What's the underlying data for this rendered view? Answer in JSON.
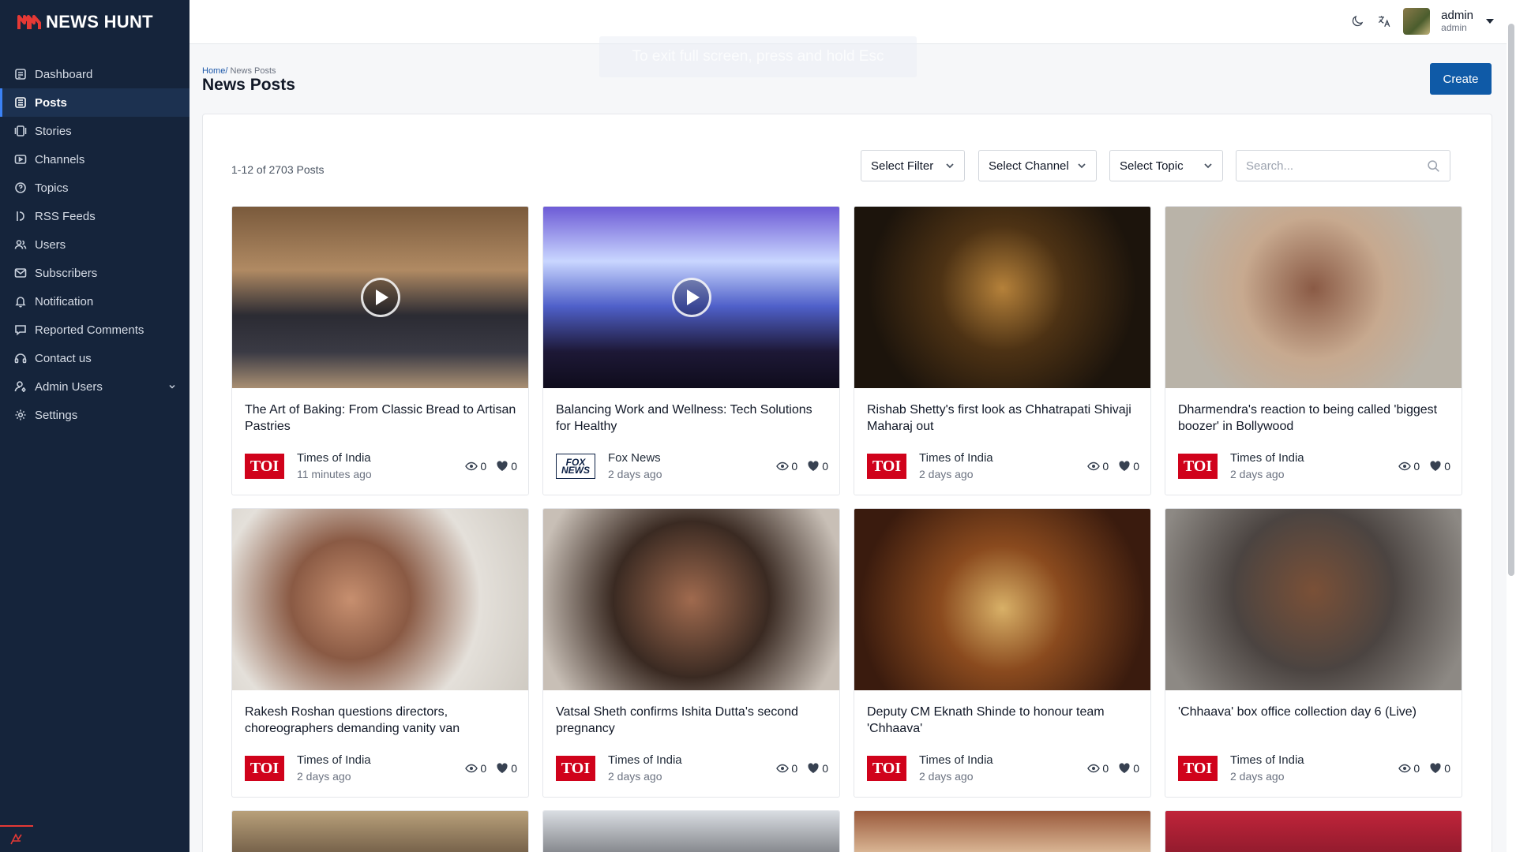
{
  "brand": {
    "name": "NEWS HUNT",
    "accent": "#e53935"
  },
  "sidebar": {
    "items": [
      {
        "label": "Dashboard",
        "icon": "dashboard-icon"
      },
      {
        "label": "Posts",
        "icon": "posts-icon",
        "active": true
      },
      {
        "label": "Stories",
        "icon": "stories-icon"
      },
      {
        "label": "Channels",
        "icon": "channels-icon"
      },
      {
        "label": "Topics",
        "icon": "topics-icon"
      },
      {
        "label": "RSS Feeds",
        "icon": "rss-icon"
      },
      {
        "label": "Users",
        "icon": "users-icon"
      },
      {
        "label": "Subscribers",
        "icon": "mail-icon"
      },
      {
        "label": "Notification",
        "icon": "bell-icon"
      },
      {
        "label": "Reported Comments",
        "icon": "comment-icon"
      },
      {
        "label": "Contact us",
        "icon": "contact-icon"
      },
      {
        "label": "Admin Users",
        "icon": "admin-icon"
      },
      {
        "label": "Settings",
        "icon": "gear-icon"
      }
    ]
  },
  "header": {
    "user_name": "admin",
    "user_role": "admin",
    "fullscreen_hint": "To exit full screen, press and hold Esc"
  },
  "page": {
    "breadcrumb_home": "Home/",
    "breadcrumb_current": " News Posts",
    "title": "News Posts",
    "create_label": "Create"
  },
  "toolbar": {
    "count": "1-12 of 2703 Posts",
    "filter_label": "Select Filter",
    "channel_label": "Select Channel",
    "topic_label": "Select Topic",
    "search_placeholder": "Search..."
  },
  "posts": [
    {
      "title": "The Art of Baking: From Classic Bread to Artisan Pastries",
      "source": "Times of India",
      "logo": "TOI",
      "time": "11 minutes ago",
      "views": "0",
      "likes": "0",
      "video": true
    },
    {
      "title": "Balancing Work and Wellness: Tech Solutions for Healthy",
      "source": "Fox News",
      "logo": "FOX NEWS",
      "time": "2 days ago",
      "views": "0",
      "likes": "0",
      "video": true
    },
    {
      "title": "Rishab Shetty's first look as Chhatrapati Shivaji Maharaj out",
      "source": "Times of India",
      "logo": "TOI",
      "time": "2 days ago",
      "views": "0",
      "likes": "0",
      "video": false
    },
    {
      "title": "Dharmendra's reaction to being called 'biggest boozer' in Bollywood",
      "source": "Times of India",
      "logo": "TOI",
      "time": "2 days ago",
      "views": "0",
      "likes": "0",
      "video": false
    },
    {
      "title": "Rakesh Roshan questions directors, choreographers demanding vanity van",
      "source": "Times of India",
      "logo": "TOI",
      "time": "2 days ago",
      "views": "0",
      "likes": "0",
      "video": false
    },
    {
      "title": "Vatsal Sheth confirms Ishita Dutta's second pregnancy",
      "source": "Times of India",
      "logo": "TOI",
      "time": "2 days ago",
      "views": "0",
      "likes": "0",
      "video": false
    },
    {
      "title": "Deputy CM Eknath Shinde to honour team 'Chhaava'",
      "source": "Times of India",
      "logo": "TOI",
      "time": "2 days ago",
      "views": "0",
      "likes": "0",
      "video": false
    },
    {
      "title": "'Chhaava' box office collection day 6 (Live)",
      "source": "Times of India",
      "logo": "TOI",
      "time": "2 days ago",
      "views": "0",
      "likes": "0",
      "video": false
    }
  ]
}
